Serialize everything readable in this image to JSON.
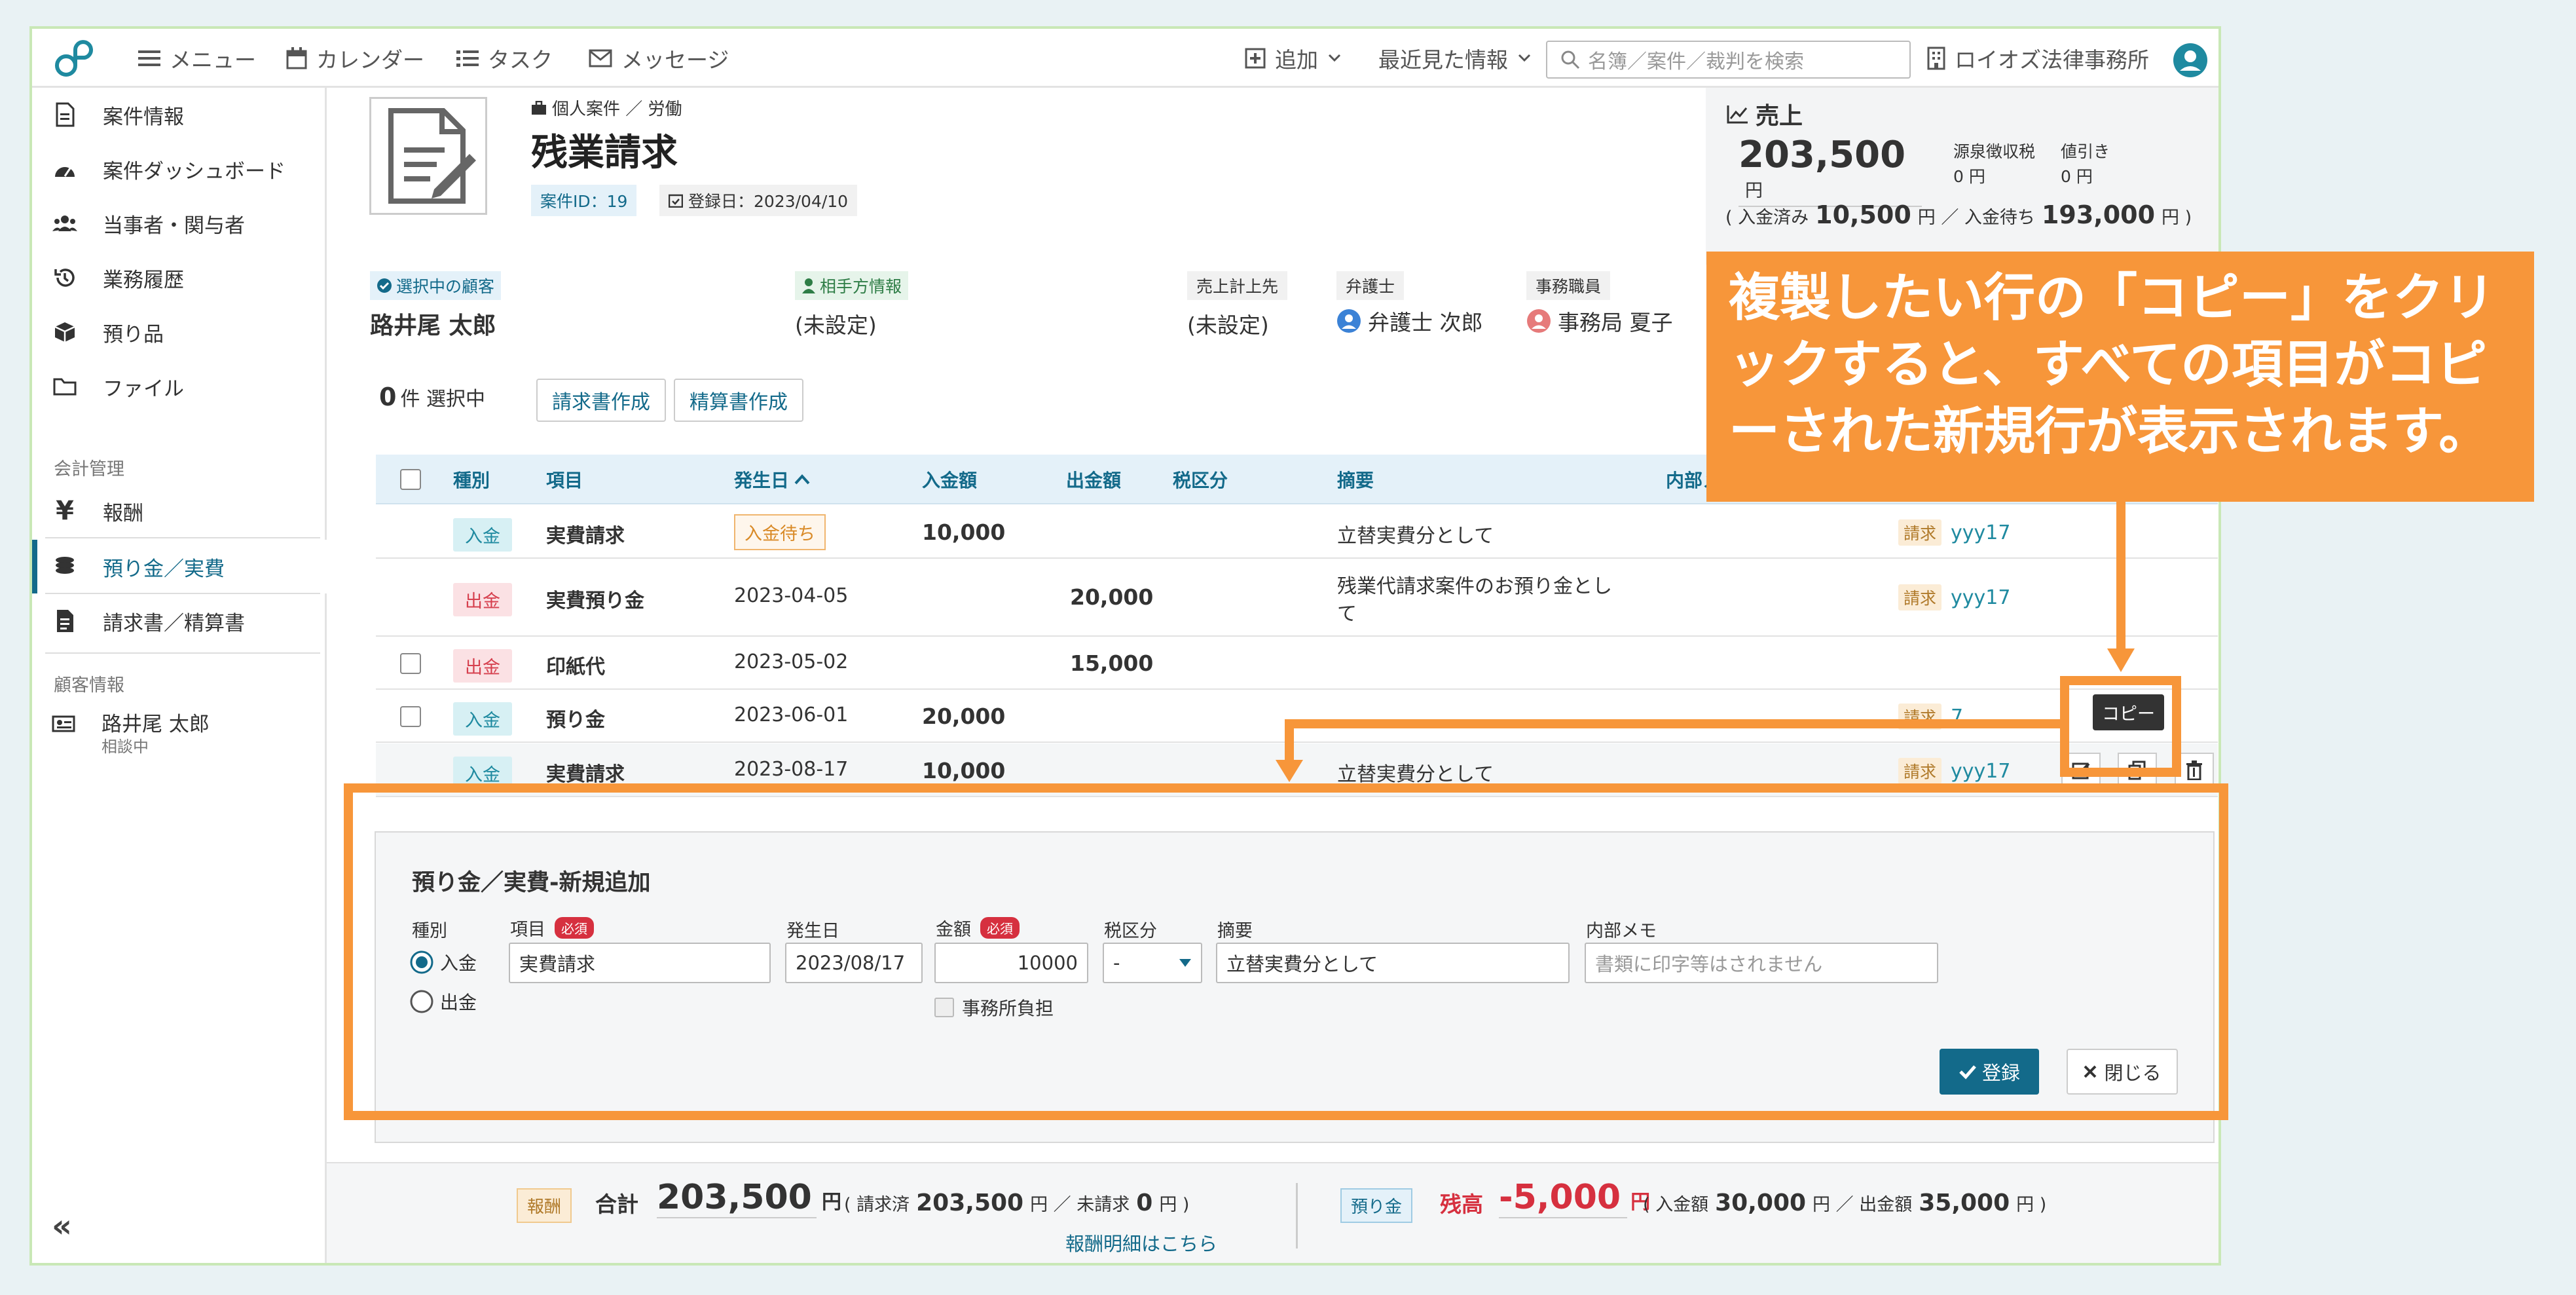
{
  "nav": {
    "menu": "メニュー",
    "calendar": "カレンダー",
    "task": "タスク",
    "message": "メッセージ",
    "add": "追加",
    "recent": "最近見た情報",
    "search_placeholder": "名簿／案件／裁判を検索",
    "office": "ロイオズ法律事務所"
  },
  "sidebar": {
    "items": [
      {
        "label": "案件情報",
        "icon": "document-icon"
      },
      {
        "label": "案件ダッシュボード",
        "icon": "dashboard-icon"
      },
      {
        "label": "当事者・関与者",
        "icon": "people-icon"
      },
      {
        "label": "業務履歴",
        "icon": "history-icon"
      },
      {
        "label": "預り品",
        "icon": "box-icon"
      },
      {
        "label": "ファイル",
        "icon": "folder-icon"
      }
    ],
    "section_accounting": "会計管理",
    "accounting": [
      {
        "label": "報酬",
        "icon": "yen-icon"
      },
      {
        "label": "預り金／実費",
        "icon": "coins-icon"
      },
      {
        "label": "請求書／精算書",
        "icon": "invoice-icon"
      }
    ],
    "section_client": "顧客情報",
    "client_name": "路井尾 太郎",
    "client_status": "相談中"
  },
  "case": {
    "category": "個人案件 ／ 労働",
    "title": "残業請求",
    "id_label": "案件ID：19",
    "registered": "登録日：2023/04/10",
    "client_label": "選択中の顧客",
    "client_name": "路井尾 太郎",
    "opponent_label": "相手方情報",
    "opponent_value": "(未設定)",
    "sales_dest_label": "売上計上先",
    "sales_dest_value": "(未設定)",
    "lawyer_label": "弁護士",
    "lawyer_value": "弁護士 次郎",
    "staff_label": "事務職員",
    "staff_value": "事務局 夏子"
  },
  "sales": {
    "title": "売上",
    "amount": "203,500",
    "unit": "円",
    "withholding_label": "源泉徴収税",
    "withholding_value": "0 円",
    "discount_label": "値引き",
    "discount_value": "0 円",
    "paid_label": "( 入金済み",
    "paid_value": "10,500",
    "pending_label": "円 ／ 入金待ち",
    "pending_value": "193,000",
    "end": "円 )"
  },
  "toolbar": {
    "count": "0",
    "selected": "件 選択中",
    "invoice_btn": "請求書作成",
    "settle_btn": "精算書作成"
  },
  "table": {
    "headers": [
      "種別",
      "項目",
      "発生日",
      "入金額",
      "出金額",
      "税区分",
      "摘要",
      "内部メモ"
    ],
    "rows": [
      {
        "type": "入金",
        "item": "実費請求",
        "date": "入金待ち",
        "in": "10,000",
        "out": "",
        "memo": "立替実費分として",
        "bill": "請求",
        "ref": "yyy17"
      },
      {
        "type": "出金",
        "item": "実費預り金",
        "date": "2023-04-05",
        "in": "",
        "out": "20,000",
        "memo": "残業代請求案件のお預り金とし",
        "memo2": "て",
        "bill": "請求",
        "ref": "yyy17"
      },
      {
        "type": "出金",
        "item": "印紙代",
        "date": "2023-05-02",
        "in": "",
        "out": "15,000",
        "memo": "",
        "bill": "",
        "ref": ""
      },
      {
        "type": "入金",
        "item": "預り金",
        "date": "2023-06-01",
        "in": "20,000",
        "out": "",
        "memo": "",
        "bill": "請求",
        "ref": "7"
      },
      {
        "type": "入金",
        "item": "実費請求",
        "date": "2023-08-17",
        "in": "10,000",
        "out": "",
        "memo": "立替実費分として",
        "bill": "請求",
        "ref": "yyy17"
      }
    ],
    "tooltip": "コピー"
  },
  "form": {
    "title": "預り金／実費-新規追加",
    "type_label": "種別",
    "opt_in": "入金",
    "opt_out": "出金",
    "item_label": "項目",
    "required": "必須",
    "item_value": "実費請求",
    "date_label": "発生日",
    "date_value": "2023/08/17",
    "amount_label": "金額",
    "amount_value": "10000",
    "tax_label": "税区分",
    "tax_value": "-",
    "memo_label": "摘要",
    "memo_value": "立替実費分として",
    "internal_label": "内部メモ",
    "internal_placeholder": "書類に印字等はされません",
    "office_burden": "事務所負担",
    "register": "登録",
    "close": "閉じる"
  },
  "footer": {
    "fee_tag": "報酬",
    "total_label": "合計",
    "total_value": "203,500",
    "yen": "円",
    "billed_label": "( 請求済",
    "billed_value": "203,500",
    "unbilled_label": "円 ／ 未請求",
    "unbilled_value": "0",
    "end": "円 )",
    "deposit_tag": "預り金",
    "balance_label": "残高",
    "balance_value": "-5,000",
    "in_label": "( 入金額",
    "in_value": "30,000",
    "out_label": "円 ／ 出金額",
    "out_value": "35,000",
    "detail_link": "報酬明細はこちら"
  },
  "callout": {
    "text": "複製したい行の「コピー」をクリックすると、すべての項目がコピーされた新規行が表示されます。"
  },
  "colors": {
    "accent": "#136a8a",
    "annotation": "#f7963a",
    "negative": "#d6303f"
  }
}
